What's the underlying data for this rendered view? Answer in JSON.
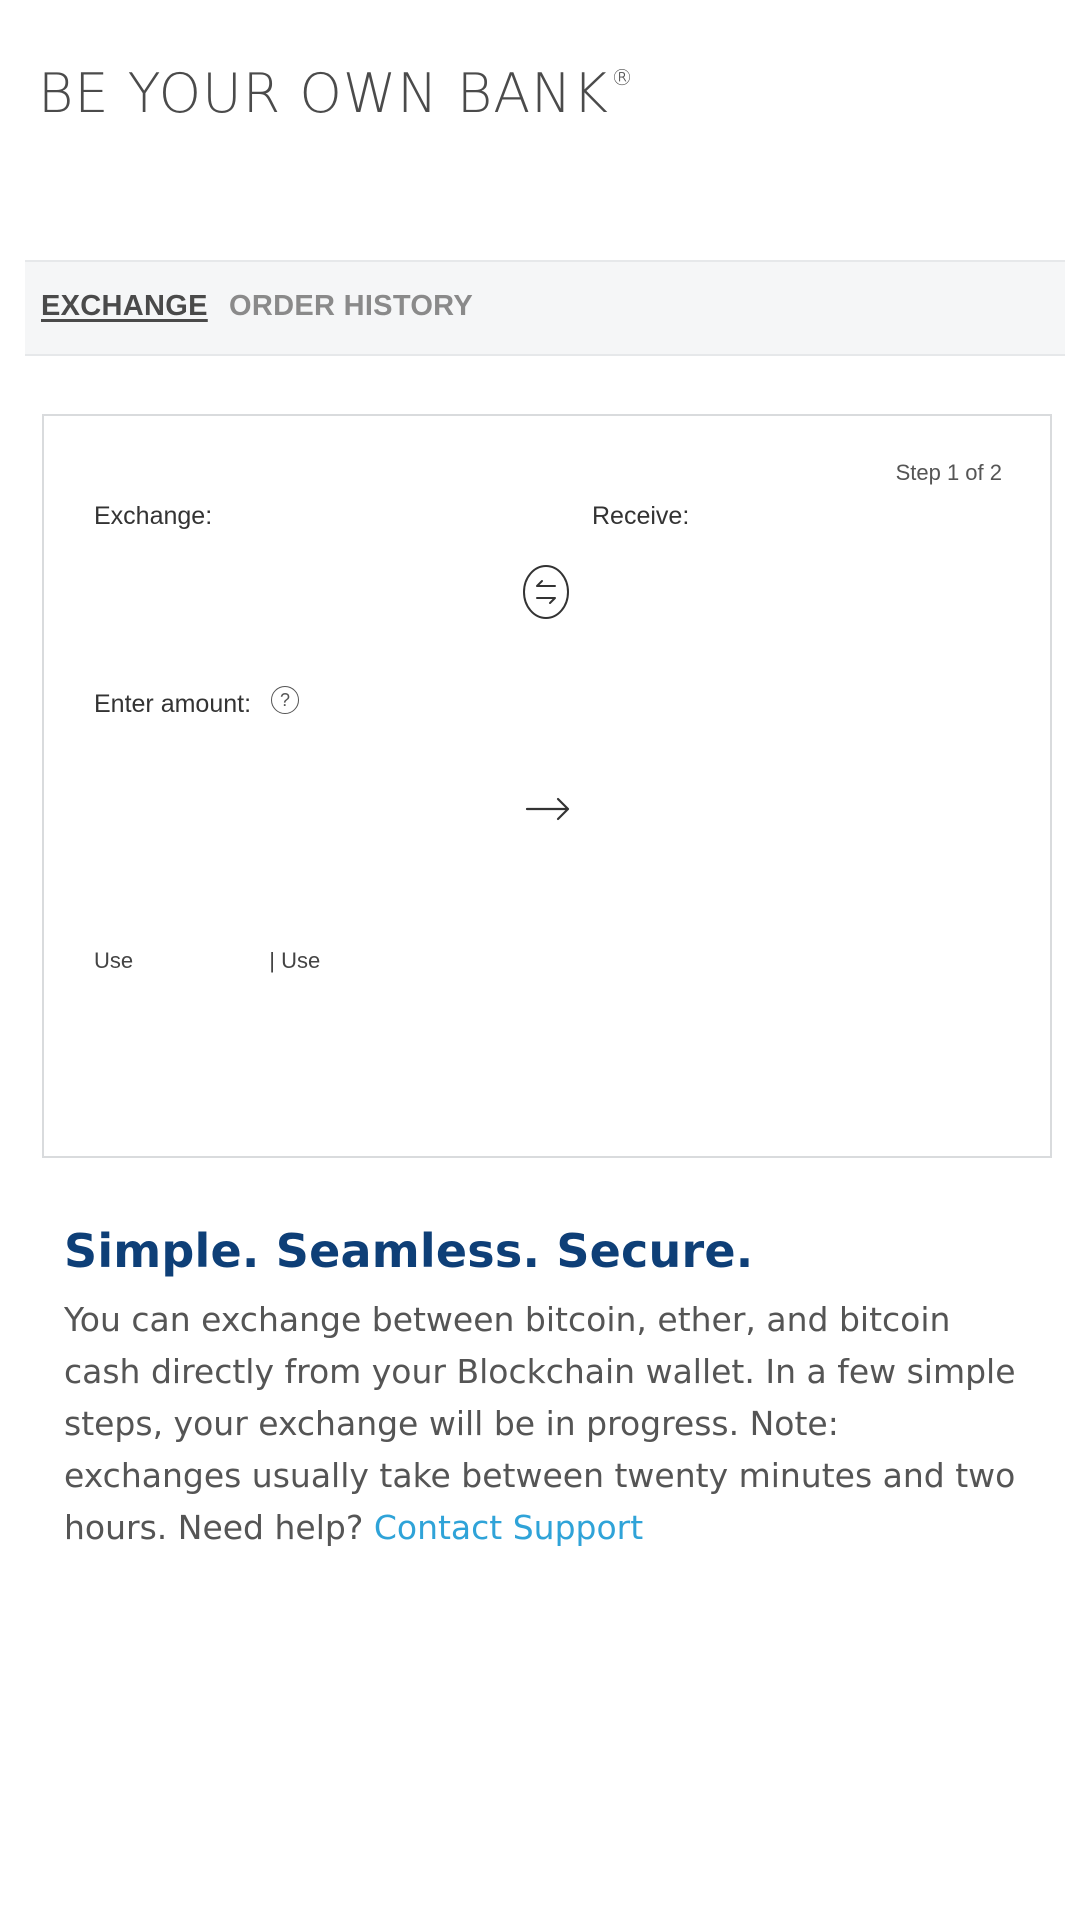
{
  "brand": {
    "title": "BE YOUR OWN BANK",
    "mark": "®"
  },
  "tabs": [
    {
      "label": "EXCHANGE",
      "active": true
    },
    {
      "label": "ORDER HISTORY",
      "active": false
    }
  ],
  "exchange_card": {
    "step_text": "Step 1 of 2",
    "exchange_label": "Exchange:",
    "receive_label": "Receive:",
    "amount_label": "Enter amount:",
    "help_icon_glyph": "?",
    "use_left": "Use",
    "use_separator": "|",
    "use_right": "Use"
  },
  "info": {
    "headline": "Simple. Seamless. Secure.",
    "description": "You can exchange between bitcoin, ether, and bitcoin cash directly from your Blockchain wallet.  In a few simple steps, your exchange will be in progress. Note: exchanges usually take between twenty minutes and two hours.  Need help?",
    "support_link": "Contact Support"
  },
  "colors": {
    "headline": "#0e3f77",
    "link": "#2fa3d8",
    "tab_active": "#4a4a4a",
    "tab_inactive": "#8a8a8a"
  },
  "icons": [
    "swap-arrows-icon",
    "right-arrow-icon",
    "help-icon"
  ]
}
